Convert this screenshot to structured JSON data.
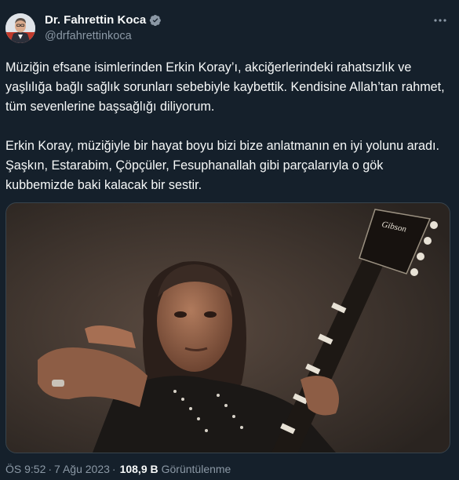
{
  "author": {
    "name": "Dr. Fahrettin Koca",
    "handle": "@drfahrettinkoca",
    "verified_color": "#8b98a5"
  },
  "more_icon": "more-dots-icon",
  "tweet": {
    "paragraph_1": "Müziğin efsane isimlerinden Erkin Koray’ı, akciğerlerindeki rahatsızlık ve yaşlılığa bağlı sağlık sorunları sebebiyle kaybettik. Kendisine Allah’tan rahmet, tüm sevenlerine başsağlığı diliyorum.",
    "paragraph_2": "Erkin Koray, müziğiyle bir hayat boyu bizi bize anlatmanın en iyi yolunu aradı. Şaşkın, Estarabim, Çöpçüler, Fesuphanallah gibi parçalarıyla o gök kubbemizde baki kalacak bir sestir."
  },
  "media": {
    "guitar_brand": "Gibson"
  },
  "meta": {
    "time": "ÖS 9:52",
    "separator": "·",
    "date": "7 Ağu 2023",
    "views_count": "108,9 B",
    "views_label": "Görüntülenme"
  },
  "colors": {
    "background": "#15202b",
    "text": "#f7f9f9",
    "secondary": "#8b98a5"
  }
}
